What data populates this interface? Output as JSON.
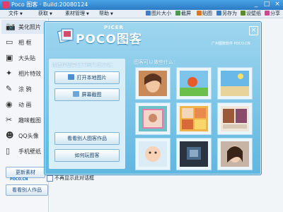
{
  "window": {
    "title": "Poco 图客 · Build:20080124",
    "controls": [
      "_",
      "□",
      "×"
    ]
  },
  "menubar": {
    "menus": [
      "文件",
      "获取",
      "素材管理",
      "帮助"
    ],
    "tools": [
      {
        "label": "图片大小",
        "icon": "picture-size-icon",
        "color": "#3c7ec4"
      },
      {
        "label": "截屏",
        "icon": "screenshot-icon",
        "color": "#4a9a4a"
      },
      {
        "label": "贴图",
        "icon": "sticker-icon",
        "color": "#d27a2a"
      },
      {
        "label": "另存为",
        "icon": "save-as-icon",
        "color": "#3c7ec4"
      },
      {
        "label": "设壁纸",
        "icon": "wallpaper-icon",
        "color": "#5a8a2a"
      },
      {
        "label": "分享",
        "icon": "share-icon",
        "color": "#c94a8a"
      }
    ]
  },
  "sidebar": {
    "items": [
      {
        "label": "美化照片",
        "icon": "camera-icon",
        "glyph": "📷"
      },
      {
        "label": "相 框",
        "icon": "frame-icon",
        "glyph": "▭"
      },
      {
        "label": "大头贴",
        "icon": "sticker-photo-icon",
        "glyph": "▣"
      },
      {
        "label": "相片特效",
        "icon": "effects-icon",
        "glyph": "✦"
      },
      {
        "label": "涂 鸦",
        "icon": "doodle-icon",
        "glyph": "✎"
      },
      {
        "label": "动 画",
        "icon": "animation-icon",
        "glyph": "◉"
      },
      {
        "label": "趣味截图",
        "icon": "scissors-icon",
        "glyph": "✂"
      },
      {
        "label": "QQ头像",
        "icon": "qq-avatar-icon",
        "glyph": "☻"
      },
      {
        "label": "手机壁纸",
        "icon": "phone-icon",
        "glyph": "▯"
      }
    ],
    "update_label": "更新素材",
    "update_sub": "POCO.CN",
    "others_label": "看看别人作品"
  },
  "dialog": {
    "logo": "POCO图客",
    "picer": "PICER",
    "brand": "广州图数软件 POCO.CN",
    "left_title": "请选择您要打开图片的方式：",
    "open_local": "打开本地图片",
    "screen_capture": "屏幕截图",
    "view_others": "看看别人图客作品",
    "how_to_play": "如何玩图客",
    "thumbs_title": "图客可以做些什么：",
    "dont_show_label": "不再显示此对话框"
  }
}
